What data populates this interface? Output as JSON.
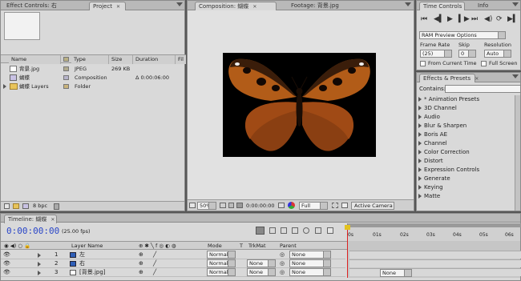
{
  "top_tabs": {
    "effect_controls": "Effect Controls: 右",
    "project": "Project",
    "composition": "Composition: 蝴蝶",
    "footage": "Footage: 背景.jpg",
    "time_controls": "Time Controls",
    "info": "Info",
    "effects_presets": "Effects & Presets"
  },
  "project": {
    "columns": [
      "Name",
      "Type",
      "Size",
      "Duration",
      "Fil"
    ],
    "items": [
      {
        "name": "背景.jpg",
        "type": "JPEG",
        "size": "269 KB",
        "duration": ""
      },
      {
        "name": "蝴蝶",
        "type": "Composition",
        "size": "",
        "duration": "Δ 0:00:06:00"
      },
      {
        "name": "蝴蝶 Layers",
        "type": "Folder",
        "size": "",
        "duration": ""
      }
    ],
    "bpc": "8 bpc"
  },
  "comp_viewer": {
    "zoom": "50%",
    "timecode": "0:00:00:00",
    "resolution": "Full",
    "camera": "Active Camera"
  },
  "time_controls": {
    "preview_option": "RAM Preview Options",
    "frame_rate_label": "Frame Rate",
    "skip_label": "Skip",
    "resolution_label": "Resolution",
    "frame_rate": "(25)",
    "skip": "0",
    "resolution": "Auto",
    "from_current_time": "From Current Time",
    "full_screen": "Full Screen"
  },
  "effects": {
    "contains_label": "Contains:",
    "contains_value": "",
    "items": [
      "* Animation Presets",
      "3D Channel",
      "Audio",
      "Blur & Sharpen",
      "Boris AE",
      "Channel",
      "Color Correction",
      "Distort",
      "Expression Controls",
      "Generate",
      "Keying",
      "Matte"
    ]
  },
  "timeline": {
    "tab": "Timeline: 蝴蝶",
    "timecode": "0:00:00:00",
    "fps": "(25.00 fps)",
    "col_layer_name": "Layer Name",
    "col_mode": "Mode",
    "col_t": "T",
    "col_trkmat": "TrkMat",
    "col_parent": "Parent",
    "ruler_labels": [
      "0s",
      "01s",
      "02s",
      "03s",
      "04s",
      "05s",
      "06s"
    ],
    "layers": [
      {
        "num": "1",
        "name": "左",
        "mode": "Normal",
        "trkmat": "",
        "parent": "None"
      },
      {
        "num": "2",
        "name": "右",
        "mode": "Normal",
        "trkmat": "None",
        "parent": "None"
      },
      {
        "num": "3",
        "name": "[背景.jpg]",
        "mode": "Normal",
        "trkmat": "None",
        "parent": "None"
      }
    ],
    "track_dropdown": "None"
  }
}
